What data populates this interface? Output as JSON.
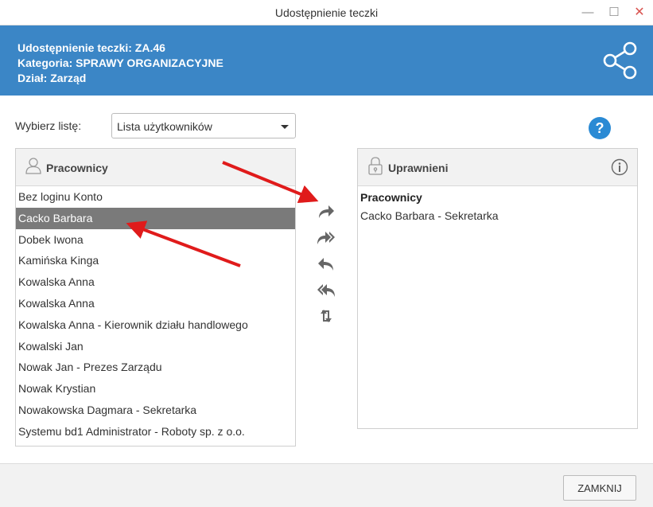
{
  "window": {
    "title": "Udostępnienie teczki",
    "minimize_label": "—",
    "maximize_label": "☐",
    "close_label": "✕"
  },
  "banner": {
    "line1": "Udostępnienie teczki: ZA.46",
    "line2": "Kategoria: SPRAWY ORGANIZACYJNE",
    "line3": "Dział: Zarząd",
    "icon": "share-icon"
  },
  "selector": {
    "label": "Wybierz listę:",
    "value": "Lista użytkowników"
  },
  "help_label": "?",
  "left_panel": {
    "title": "Pracownicy",
    "icon": "user-icon",
    "items": [
      {
        "label": "Bez loginu Konto"
      },
      {
        "label": "Cacko Barbara"
      },
      {
        "label": "Dobek Iwona"
      },
      {
        "label": "Kamińska Kinga"
      },
      {
        "label": "Kowalska Anna"
      },
      {
        "label": "Kowalska Anna"
      },
      {
        "label": "Kowalska Anna - Kierownik działu handlowego"
      },
      {
        "label": "Kowalski Jan"
      },
      {
        "label": "Nowak Jan - Prezes Zarządu"
      },
      {
        "label": "Nowak Krystian"
      },
      {
        "label": "Nowakowska Dagmara - Sekretarka"
      },
      {
        "label": "Systemu bd1 Administrator - Roboty sp. z o.o."
      }
    ],
    "selected_index": 1
  },
  "right_panel": {
    "title": "Uprawnieni",
    "icon": "lock-icon",
    "info_icon": "info-icon",
    "group": "Pracownicy",
    "items": [
      {
        "label": "Cacko Barbara - Sekretarka"
      }
    ]
  },
  "move_buttons": [
    "move-right-icon",
    "move-all-right-icon",
    "move-left-icon",
    "move-all-left-icon",
    "swap-icon"
  ],
  "colors": {
    "banner": "#3b86c6",
    "selected_row": "#7a7a7a",
    "help": "#2a8ad4",
    "annotation_arrow": "#e01b1b"
  },
  "footer": {
    "close_button": "ZAMKNIJ"
  }
}
